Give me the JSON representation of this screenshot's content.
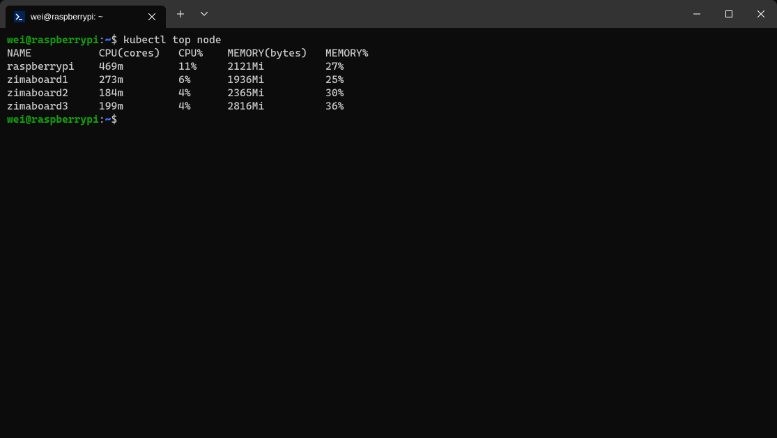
{
  "titlebar": {
    "tab_title": "wei@raspberrypi: ~",
    "tab_icon_glyph": ">_"
  },
  "prompt": {
    "user_host": "wei@raspberrypi",
    "separator": ":",
    "path": "~",
    "symbol": "$"
  },
  "command": "kubectl top node",
  "table": {
    "headers": {
      "name": "NAME",
      "cpu_cores": "CPU(cores)",
      "cpu_pct": "CPU%",
      "mem_bytes": "MEMORY(bytes)",
      "mem_pct": "MEMORY%"
    },
    "rows": [
      {
        "name": "raspberrypi",
        "cpu_cores": "469m",
        "cpu_pct": "11%",
        "mem_bytes": "2121Mi",
        "mem_pct": "27%"
      },
      {
        "name": "zimaboard1",
        "cpu_cores": "273m",
        "cpu_pct": "6%",
        "mem_bytes": "1936Mi",
        "mem_pct": "25%"
      },
      {
        "name": "zimaboard2",
        "cpu_cores": "184m",
        "cpu_pct": "4%",
        "mem_bytes": "2365Mi",
        "mem_pct": "30%"
      },
      {
        "name": "zimaboard3",
        "cpu_cores": "199m",
        "cpu_pct": "4%",
        "mem_bytes": "2816Mi",
        "mem_pct": "36%"
      }
    ]
  },
  "cols": {
    "name": 15,
    "cpu_cores": 13,
    "cpu_pct": 8,
    "mem_bytes": 16
  }
}
